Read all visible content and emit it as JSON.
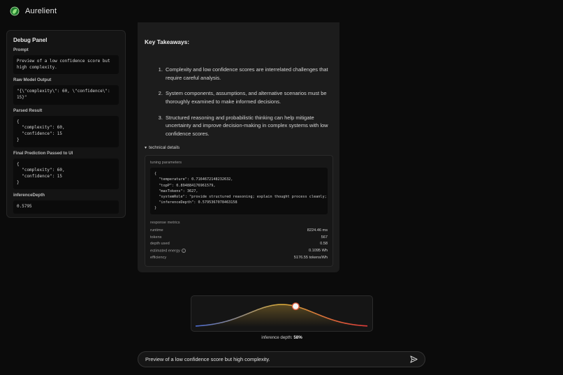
{
  "app": {
    "title": "Aurelient"
  },
  "debug": {
    "title": "Debug Panel",
    "prompt_label": "Prompt",
    "prompt_value": "Preview of a low confidence score but\nhigh complexity.",
    "raw_label": "Raw Model Output",
    "raw_value": "\"{\\\"complexity\\\": 60, \\\"confidence\\\":\n15}\"",
    "parsed_label": "Parsed Result",
    "parsed_value": "{\n  \"complexity\": 60,\n  \"confidence\": 15\n}",
    "final_label": "Final Prediction Passed to UI",
    "final_value": "{\n  \"complexity\": 60,\n  \"confidence\": 15\n}",
    "depth_label": "inferenceDepth",
    "depth_value": "0.5795"
  },
  "main": {
    "heading": "Key Takeaways:",
    "takeaways": [
      "Complexity and low confidence scores are interrelated challenges that require careful analysis.",
      "System components, assumptions, and alternative scenarios must be thoroughly examined to make informed decisions.",
      "Structured reasoning and probabilistic thinking can help mitigate uncertainty and improve decision-making in complex systems with low confidence scores."
    ],
    "technical_toggle": "technical details",
    "tuning_label": "tuning parameters",
    "tuning_code": "{\n  \"temperature\": 0.7164672148232632,\n  \"topP\": 0.894884176961579,\n  \"maxTokens\": 3627,\n  \"systemRole\": \"provide structured reasoning; explain thought process cleanly;\n  \"inferenceDepth\": 0.5795367078463158\n}",
    "metrics_label": "response metrics",
    "metrics": [
      {
        "label": "runtime",
        "value": "8224.46 ms"
      },
      {
        "label": "tokens",
        "value": "567"
      },
      {
        "label": "depth used",
        "value": "0.58"
      },
      {
        "label": "estimated energy",
        "value": "0.1095 Wh"
      },
      {
        "label": "efficiency",
        "value": "5176.55 tokens/Wh"
      }
    ]
  },
  "slider": {
    "label_prefix": "inference depth:",
    "label_value": "58%",
    "level": 0.58,
    "colors": {
      "low": "#4a6ad0",
      "mid": "#d7a93a",
      "high": "#e03a3a"
    }
  },
  "chat": {
    "input_value": "Preview of a low confidence score but high complexity."
  }
}
